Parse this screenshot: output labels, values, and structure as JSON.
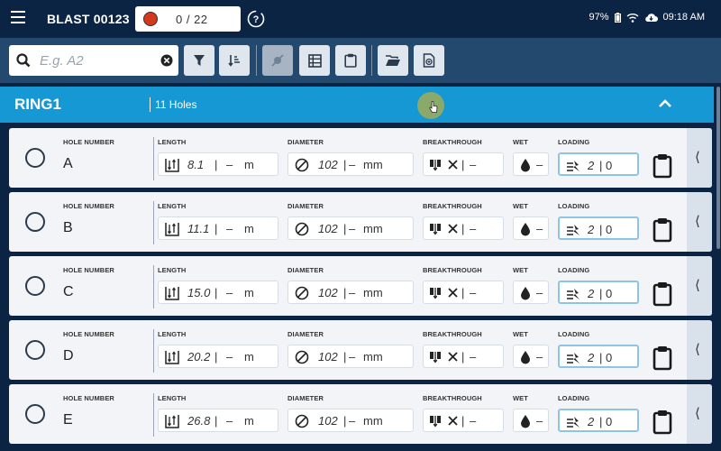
{
  "header": {
    "title": "BLAST 00123",
    "progress": "0 / 22",
    "battery": "97%",
    "time": "09:18 AM"
  },
  "toolbar": {
    "search_placeholder": "E.g. A2"
  },
  "ring": {
    "title": "RING1",
    "holes_count": "11 Holes"
  },
  "labels": {
    "hole_number": "HOLE NUMBER",
    "length": "LENGTH",
    "diameter": "DIAMETER",
    "breakthrough": "BREAKTHROUGH",
    "wet": "WET",
    "loading": "LOADING"
  },
  "holes": [
    {
      "id": "A",
      "length": "8.1",
      "length_sep": "|",
      "length_dash": "–",
      "length_unit": "m",
      "diameter": "102",
      "diameter_sep": "|",
      "diameter_dash": "–",
      "diameter_unit": "mm",
      "breakthrough": "–",
      "breakthrough_sep": "|",
      "wet": "–",
      "loading_a": "2",
      "loading_sep": "|",
      "loading_b": "0"
    },
    {
      "id": "B",
      "length": "11.1",
      "length_sep": "|",
      "length_dash": "–",
      "length_unit": "m",
      "diameter": "102",
      "diameter_sep": "|",
      "diameter_dash": "–",
      "diameter_unit": "mm",
      "breakthrough": "–",
      "breakthrough_sep": "|",
      "wet": "–",
      "loading_a": "2",
      "loading_sep": "|",
      "loading_b": "0"
    },
    {
      "id": "C",
      "length": "15.0",
      "length_sep": "|",
      "length_dash": "–",
      "length_unit": "m",
      "diameter": "102",
      "diameter_sep": "|",
      "diameter_dash": "–",
      "diameter_unit": "mm",
      "breakthrough": "–",
      "breakthrough_sep": "|",
      "wet": "–",
      "loading_a": "2",
      "loading_sep": "|",
      "loading_b": "0"
    },
    {
      "id": "D",
      "length": "20.2",
      "length_sep": "|",
      "length_dash": "–",
      "length_unit": "m",
      "diameter": "102",
      "diameter_sep": "|",
      "diameter_dash": "–",
      "diameter_unit": "mm",
      "breakthrough": "–",
      "breakthrough_sep": "|",
      "wet": "–",
      "loading_a": "2",
      "loading_sep": "|",
      "loading_b": "0"
    },
    {
      "id": "E",
      "length": "26.8",
      "length_sep": "|",
      "length_dash": "–",
      "length_unit": "m",
      "diameter": "102",
      "diameter_sep": "|",
      "diameter_dash": "–",
      "diameter_unit": "mm",
      "breakthrough": "–",
      "breakthrough_sep": "|",
      "wet": "–",
      "loading_a": "2",
      "loading_sep": "|",
      "loading_b": "0"
    }
  ],
  "side_tab_glyph": "⟨",
  "colors": {
    "topbar": "#0c2444",
    "toolbar": "#23496f",
    "ring_header": "#1598d4",
    "progress_dot": "#d3391c"
  }
}
